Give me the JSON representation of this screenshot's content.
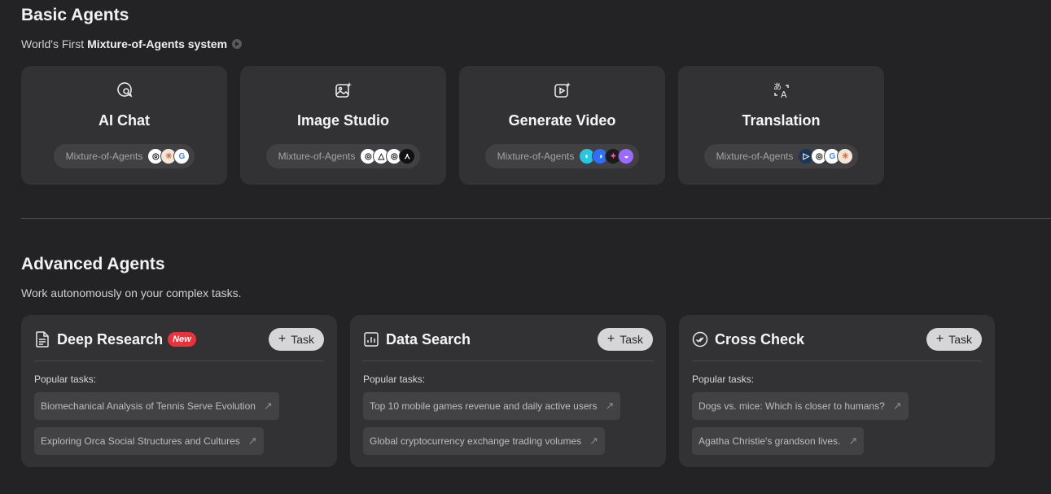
{
  "basic": {
    "title": "Basic Agents",
    "subtitle_prefix": "World's First",
    "subtitle_bold": "Mixture-of-Agents system",
    "cards": [
      {
        "title": "AI Chat",
        "pill": "Mixture-of-Agents",
        "icon": "chat-search-icon",
        "logos": [
          "openai-logo",
          "claude-logo",
          "google-logo"
        ]
      },
      {
        "title": "Image Studio",
        "pill": "Mixture-of-Agents",
        "icon": "image-sparkle-icon",
        "logos": [
          "openai-logo",
          "triangle-logo",
          "openai-logo",
          "black-logo"
        ]
      },
      {
        "title": "Generate Video",
        "pill": "Mixture-of-Agents",
        "icon": "video-sparkle-icon",
        "logos": [
          "cyan-logo",
          "blue-logo",
          "pink-logo",
          "purple-logo"
        ]
      },
      {
        "title": "Translation",
        "pill": "Mixture-of-Agents",
        "icon": "translate-icon",
        "logos": [
          "dark-logo",
          "openai-logo",
          "google-logo",
          "claude-logo"
        ]
      }
    ]
  },
  "advanced": {
    "title": "Advanced Agents",
    "subtitle": "Work autonomously on your complex tasks.",
    "cards": [
      {
        "title": "Deep Research",
        "badge": "New",
        "task_label": "Task",
        "popular_label": "Popular tasks:",
        "icon": "document-icon",
        "tasks": [
          "Biomechanical Analysis of Tennis Serve Evolution",
          "Exploring Orca Social Structures and Cultures"
        ]
      },
      {
        "title": "Data Search",
        "badge": "",
        "task_label": "Task",
        "popular_label": "Popular tasks:",
        "icon": "bar-chart-icon",
        "tasks": [
          "Top 10 mobile games revenue and daily active users",
          "Global cryptocurrency exchange trading volumes"
        ]
      },
      {
        "title": "Cross Check",
        "badge": "",
        "task_label": "Task",
        "popular_label": "Popular tasks:",
        "icon": "check-circle-icon",
        "tasks": [
          "Dogs vs. mice: Which is closer to humans?",
          "Agatha Christie's grandson lives."
        ]
      }
    ]
  },
  "colors": {
    "background": "#232325",
    "card": "#323234",
    "badge": "#e8333d"
  }
}
